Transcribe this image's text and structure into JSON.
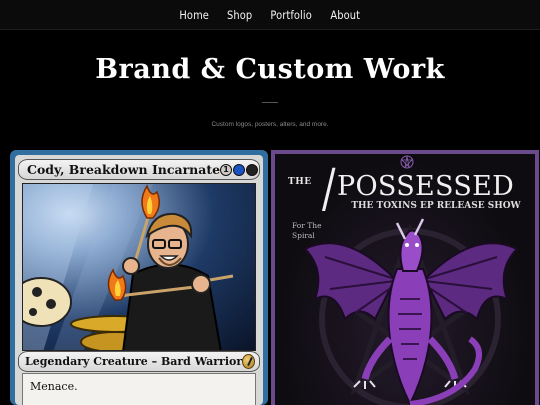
{
  "nav": {
    "items": [
      "Home",
      "Shop",
      "Portfolio",
      "About"
    ]
  },
  "hero": {
    "title": "Brand & Custom Work",
    "subtitle": "Custom logos, posters, alters, and more."
  },
  "card": {
    "name": "Cody, Breakdown Incarnate",
    "mana": [
      "1",
      "blue",
      "black"
    ],
    "type_line": "Legendary Creature – Bard Warrior",
    "rules_text": "Menace."
  },
  "poster": {
    "the": "THE",
    "band": "POSSESSED",
    "event": "THE TOXINS EP RELEASE SHOW",
    "venue": "For The Spiral"
  },
  "colors": {
    "background": "#000000",
    "card_frame_blue": "#2f6e9e",
    "poster_border": "#6a4a8a",
    "dragon_purple": "#8a3fb8"
  }
}
